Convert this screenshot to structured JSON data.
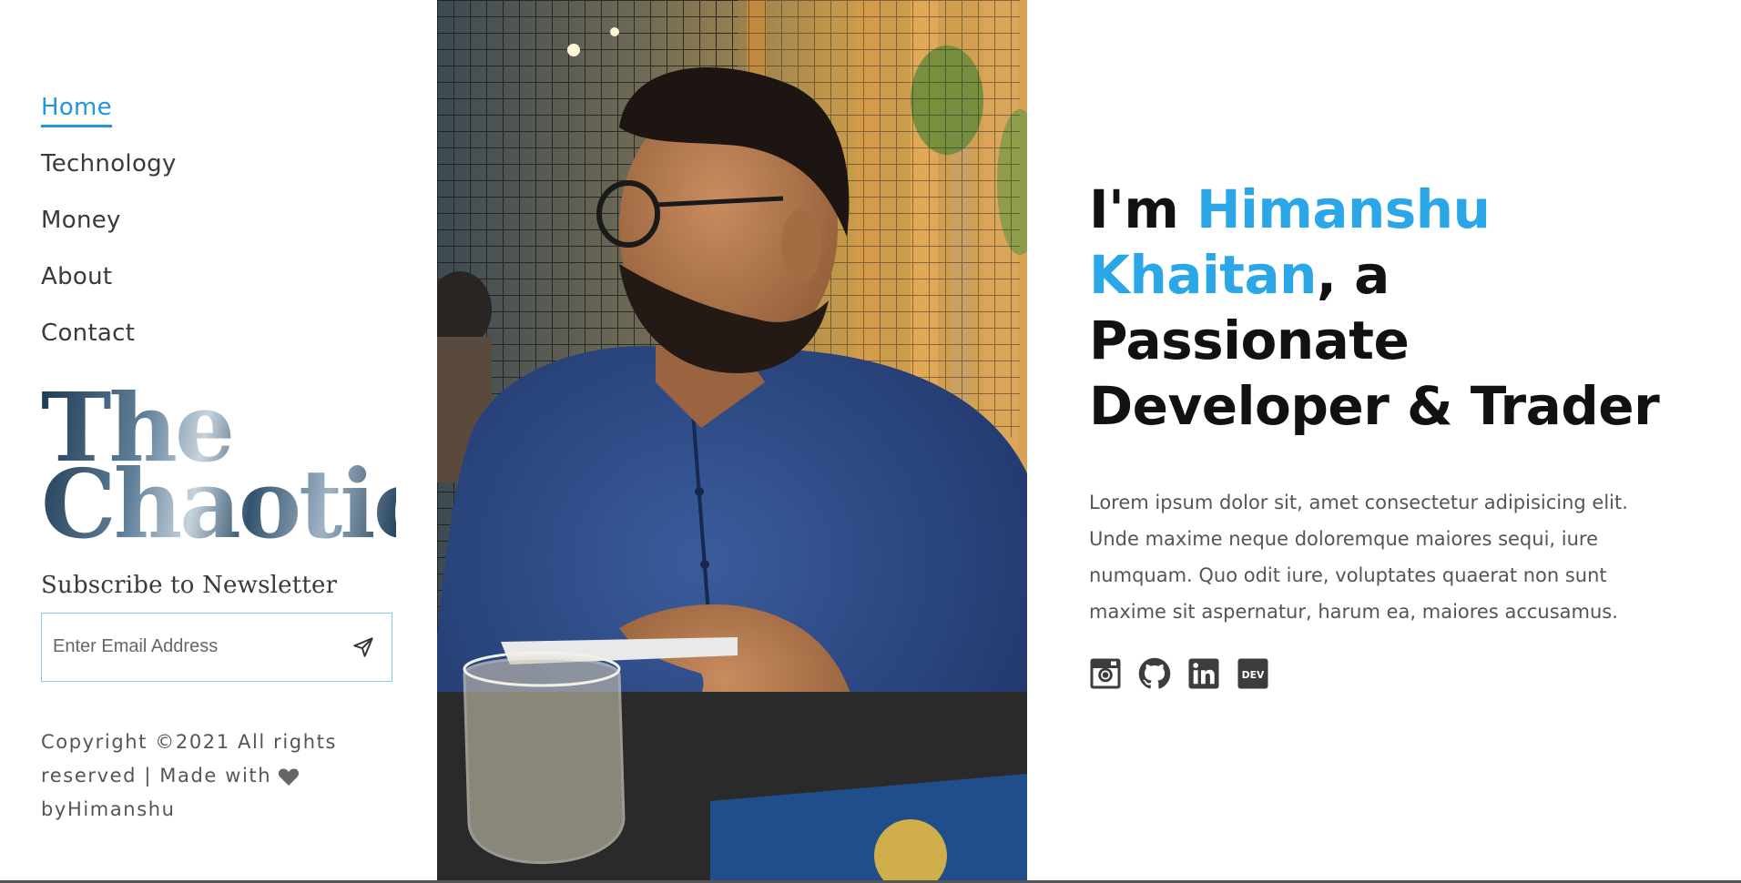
{
  "nav": {
    "items": [
      {
        "label": "Home",
        "active": true
      },
      {
        "label": "Technology"
      },
      {
        "label": "Money"
      },
      {
        "label": "About"
      },
      {
        "label": "Contact"
      }
    ]
  },
  "logo": {
    "line1": "The",
    "line2": "Chaotic"
  },
  "newsletter": {
    "title": "Subscribe to Newsletter",
    "placeholder": "Enter Email Address",
    "send_icon": "send-icon"
  },
  "footer": {
    "line1": "Copyright ©2021 All rights",
    "line2": "reserved | Made with",
    "line3": "byHimanshu",
    "heart_icon": "heart-icon"
  },
  "hero": {
    "prefix": "I'm ",
    "name_part1": "Himanshu",
    "name_part2": "Khaitan",
    "suffix": ", a",
    "line3": "Passionate",
    "line4": "Developer & Trader",
    "bio": "Lorem ipsum dolor sit, amet consectetur adipisicing elit. Unde maxime neque doloremque maiores sequi, iure numquam. Quo odit iure, voluptates quaerat non sunt maxime sit aspernatur, harum ea, maiores accusamus."
  },
  "socials": [
    "instagram-icon",
    "github-icon",
    "linkedin-icon",
    "dev-icon"
  ],
  "dev_label": "DEV",
  "colors": {
    "accent": "#2ba6e7",
    "nav_active": "#2196d8",
    "input_border": "#7fd3e3",
    "text": "#333333"
  }
}
